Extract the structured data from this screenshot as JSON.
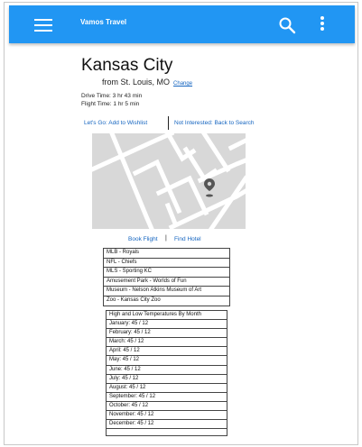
{
  "app": {
    "title": "Vamos Travel"
  },
  "icons": {
    "menu": "menu-icon",
    "search": "search-icon",
    "more": "more-vert-icon",
    "map_pin": "map-pin-icon"
  },
  "colors": {
    "appbar": "#2196f3",
    "link": "#1565c0"
  },
  "destination": {
    "city": "Kansas City",
    "from": "from St. Louis, MO",
    "change_label": "Change",
    "drive_time": "Drive Time: 3 hr 43 min",
    "flight_time": "Flight Time: 1 hr 5 min"
  },
  "actions": {
    "wishlist": "Let's Go: Add to Wishlist",
    "not_interested": "Not Interested: Back to Search",
    "book_flight": "Book Flight",
    "separator": "|",
    "find_hotel": "Find Hotel"
  },
  "attractions": [
    "MLB - Royals",
    "NFL - Chiefs",
    "MLS - Sporting KC",
    "Amusement Park - Worlds of Fun",
    "Museum - Nelson Atkins Museum of Art",
    "Zoo - Kansas City Zoo"
  ],
  "temperatures": {
    "header": "High and Low Temperatures By Month",
    "months": [
      "January: 45 / 12",
      "February: 45 / 12",
      "March: 45 / 12",
      "April: 45 / 12",
      "May: 45 / 12",
      "June: 45 / 12",
      "July: 45 / 12",
      "August: 45 / 12",
      "September: 45 / 12",
      "October: 45 / 12",
      "November: 45 / 12",
      "December: 45 / 12"
    ]
  }
}
